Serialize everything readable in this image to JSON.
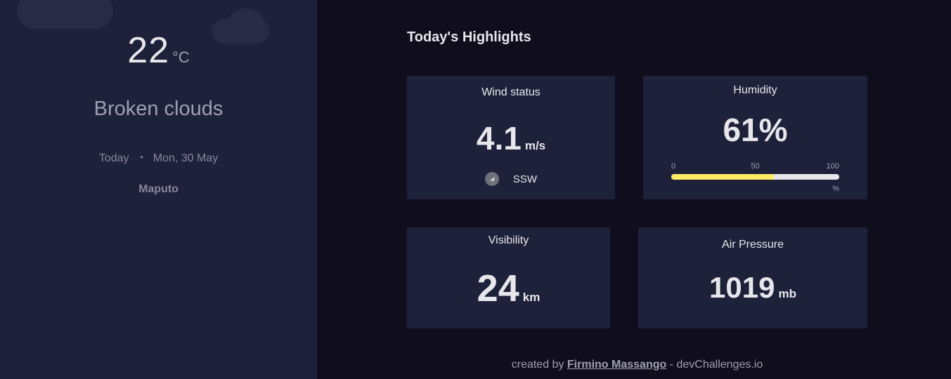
{
  "sidebar": {
    "temperature": {
      "value": "22",
      "unit": "°C"
    },
    "condition": "Broken clouds",
    "date": {
      "today_label": "Today",
      "separator": "•",
      "date": "Mon, 30 May"
    },
    "location": "Maputo"
  },
  "highlights": {
    "title": "Today's Highlights",
    "wind": {
      "title": "Wind status",
      "value": "4.1",
      "unit": "m/s",
      "direction": "SSW",
      "icon": "navigation-arrow-icon"
    },
    "humidity": {
      "title": "Humidity",
      "value": "61%",
      "percent": 61,
      "scale": [
        "0",
        "50",
        "100"
      ],
      "unit_label": "%"
    },
    "visibility": {
      "title": "Visibility",
      "value": "24",
      "unit": "km"
    },
    "pressure": {
      "title": "Air Pressure",
      "value": "1019",
      "unit": "mb"
    }
  },
  "footer": {
    "prefix": "created by",
    "author": "Firmino Massango",
    "suffix": "- devChallenges.io"
  },
  "colors": {
    "sidebar_bg": "#1E213A",
    "page_bg": "#100E1D",
    "card_bg": "#1E213A",
    "humidity_fill": "#FFEC65",
    "humidity_track": "#E7E7EB"
  }
}
